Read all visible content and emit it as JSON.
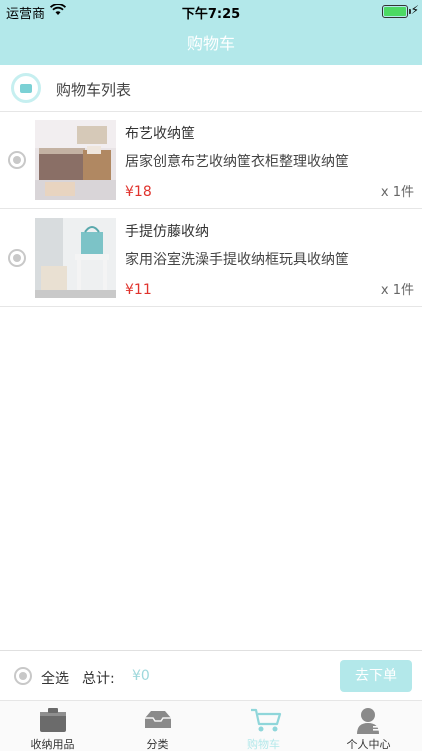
{
  "status": {
    "carrier": "运营商",
    "time": "下午7:25"
  },
  "header": {
    "title": "购物车"
  },
  "list": {
    "title": "购物车列表"
  },
  "items": [
    {
      "name": "布艺收纳筐",
      "desc": "居家创意布艺收纳筐衣柜整理收纳筐",
      "price": "¥18",
      "qty": "x 1件"
    },
    {
      "name": "手提仿藤收纳",
      "desc": "家用浴室洗澡手提收纳框玩具收纳筐",
      "price": "¥11",
      "qty": "x 1件"
    }
  ],
  "footer": {
    "select_all": "全选",
    "total_label": "总计:",
    "total_value": "¥0",
    "order_button": "去下单"
  },
  "tabs": [
    {
      "label": "收纳用品",
      "icon": "basket-icon"
    },
    {
      "label": "分类",
      "icon": "tray-icon"
    },
    {
      "label": "购物车",
      "icon": "cart-icon"
    },
    {
      "label": "个人中心",
      "icon": "user-icon"
    }
  ],
  "colors": {
    "accent": "#b3e8ea",
    "price": "#e0332d"
  }
}
